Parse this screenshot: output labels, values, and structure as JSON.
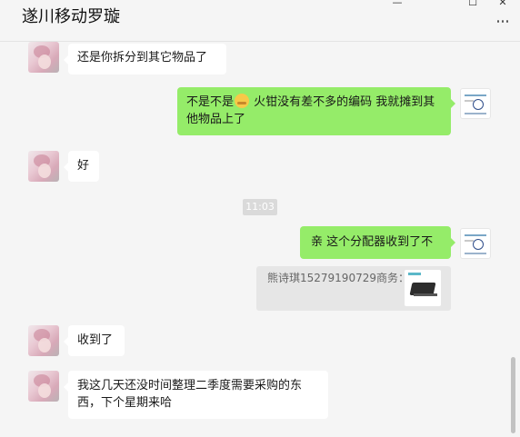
{
  "window": {
    "title": "遂川移动罗璇",
    "controls": {
      "minimize": "—",
      "maximize": "☐",
      "close": "✕"
    }
  },
  "chat": {
    "time_divider": "11:03",
    "messages": [
      {
        "side": "in",
        "text": "还是你拆分到其它物品了"
      },
      {
        "side": "out",
        "text_before_emoji": "不是不是",
        "emoji": "sweat-smile",
        "text_after_emoji": " 火钳没有差不多的编码 我就摊到其他物品上了"
      },
      {
        "side": "in",
        "text": "好"
      },
      {
        "side": "out",
        "text": "亲 这个分配器收到了不",
        "quote": {
          "text": "熊诗琪15279190729商务："
        }
      },
      {
        "side": "in",
        "text": "收到了"
      },
      {
        "side": "in",
        "text": "我这几天还没时间整理二季度需要采购的东西，下个星期来哈"
      }
    ]
  },
  "colors": {
    "incoming_bubble": "#ffffff",
    "outgoing_bubble": "#95ec69",
    "background": "#f5f5f5"
  },
  "icons": {
    "more": "more-dots-icon",
    "emoji": "sweat-smile-emoji-icon"
  }
}
